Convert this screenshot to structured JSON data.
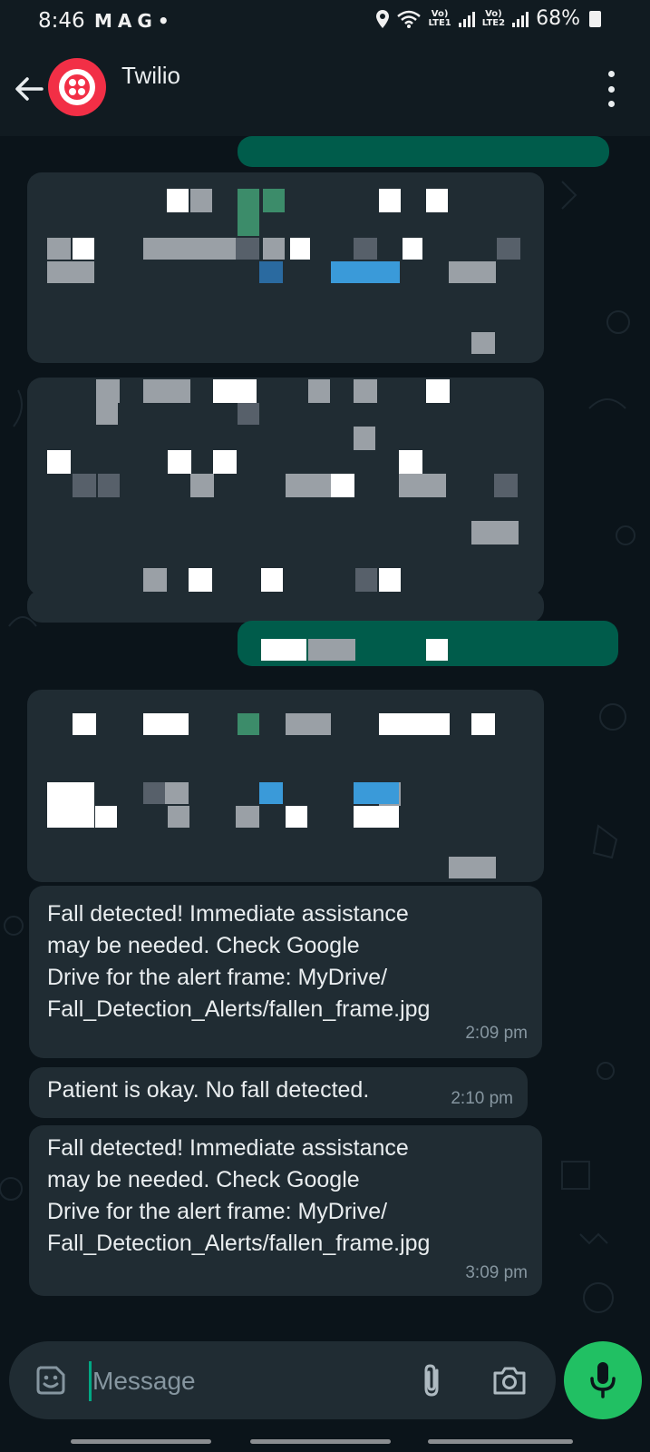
{
  "status_bar": {
    "time": "8:46",
    "notification_icons": [
      "M",
      "A",
      "G",
      "•"
    ],
    "network_1": "LTE1",
    "network_2": "LTE2",
    "battery": "68%"
  },
  "header": {
    "contact_name": "Twilio"
  },
  "messages": [
    {
      "text": "Fall detected! Immediate assistance\nmay be needed. Check Google\nDrive for the alert frame: MyDrive/\nFall_Detection_Alerts/fallen_frame.jpg",
      "time": "2:09 pm"
    },
    {
      "text": "Patient is okay. No fall detected.",
      "time": "2:10 pm"
    },
    {
      "text": "Fall detected! Immediate assistance\nmay be needed. Check Google\nDrive for the alert frame: MyDrive/\nFall_Detection_Alerts/fallen_frame.jpg",
      "time": "3:09 pm"
    }
  ],
  "composer": {
    "placeholder": "Message"
  },
  "colors": {
    "header_bg": "#111b21",
    "chat_bg": "#0b141a",
    "incoming_bubble": "#202c33",
    "outgoing_bubble": "#005c4b",
    "accent_green": "#21c063",
    "twilio_red": "#f22f46"
  },
  "icons": {
    "back": "arrow-left-icon",
    "menu": "more-vertical-icon",
    "emoji": "sticker-icon",
    "attach": "paperclip-icon",
    "camera": "camera-icon",
    "mic": "microphone-icon"
  }
}
